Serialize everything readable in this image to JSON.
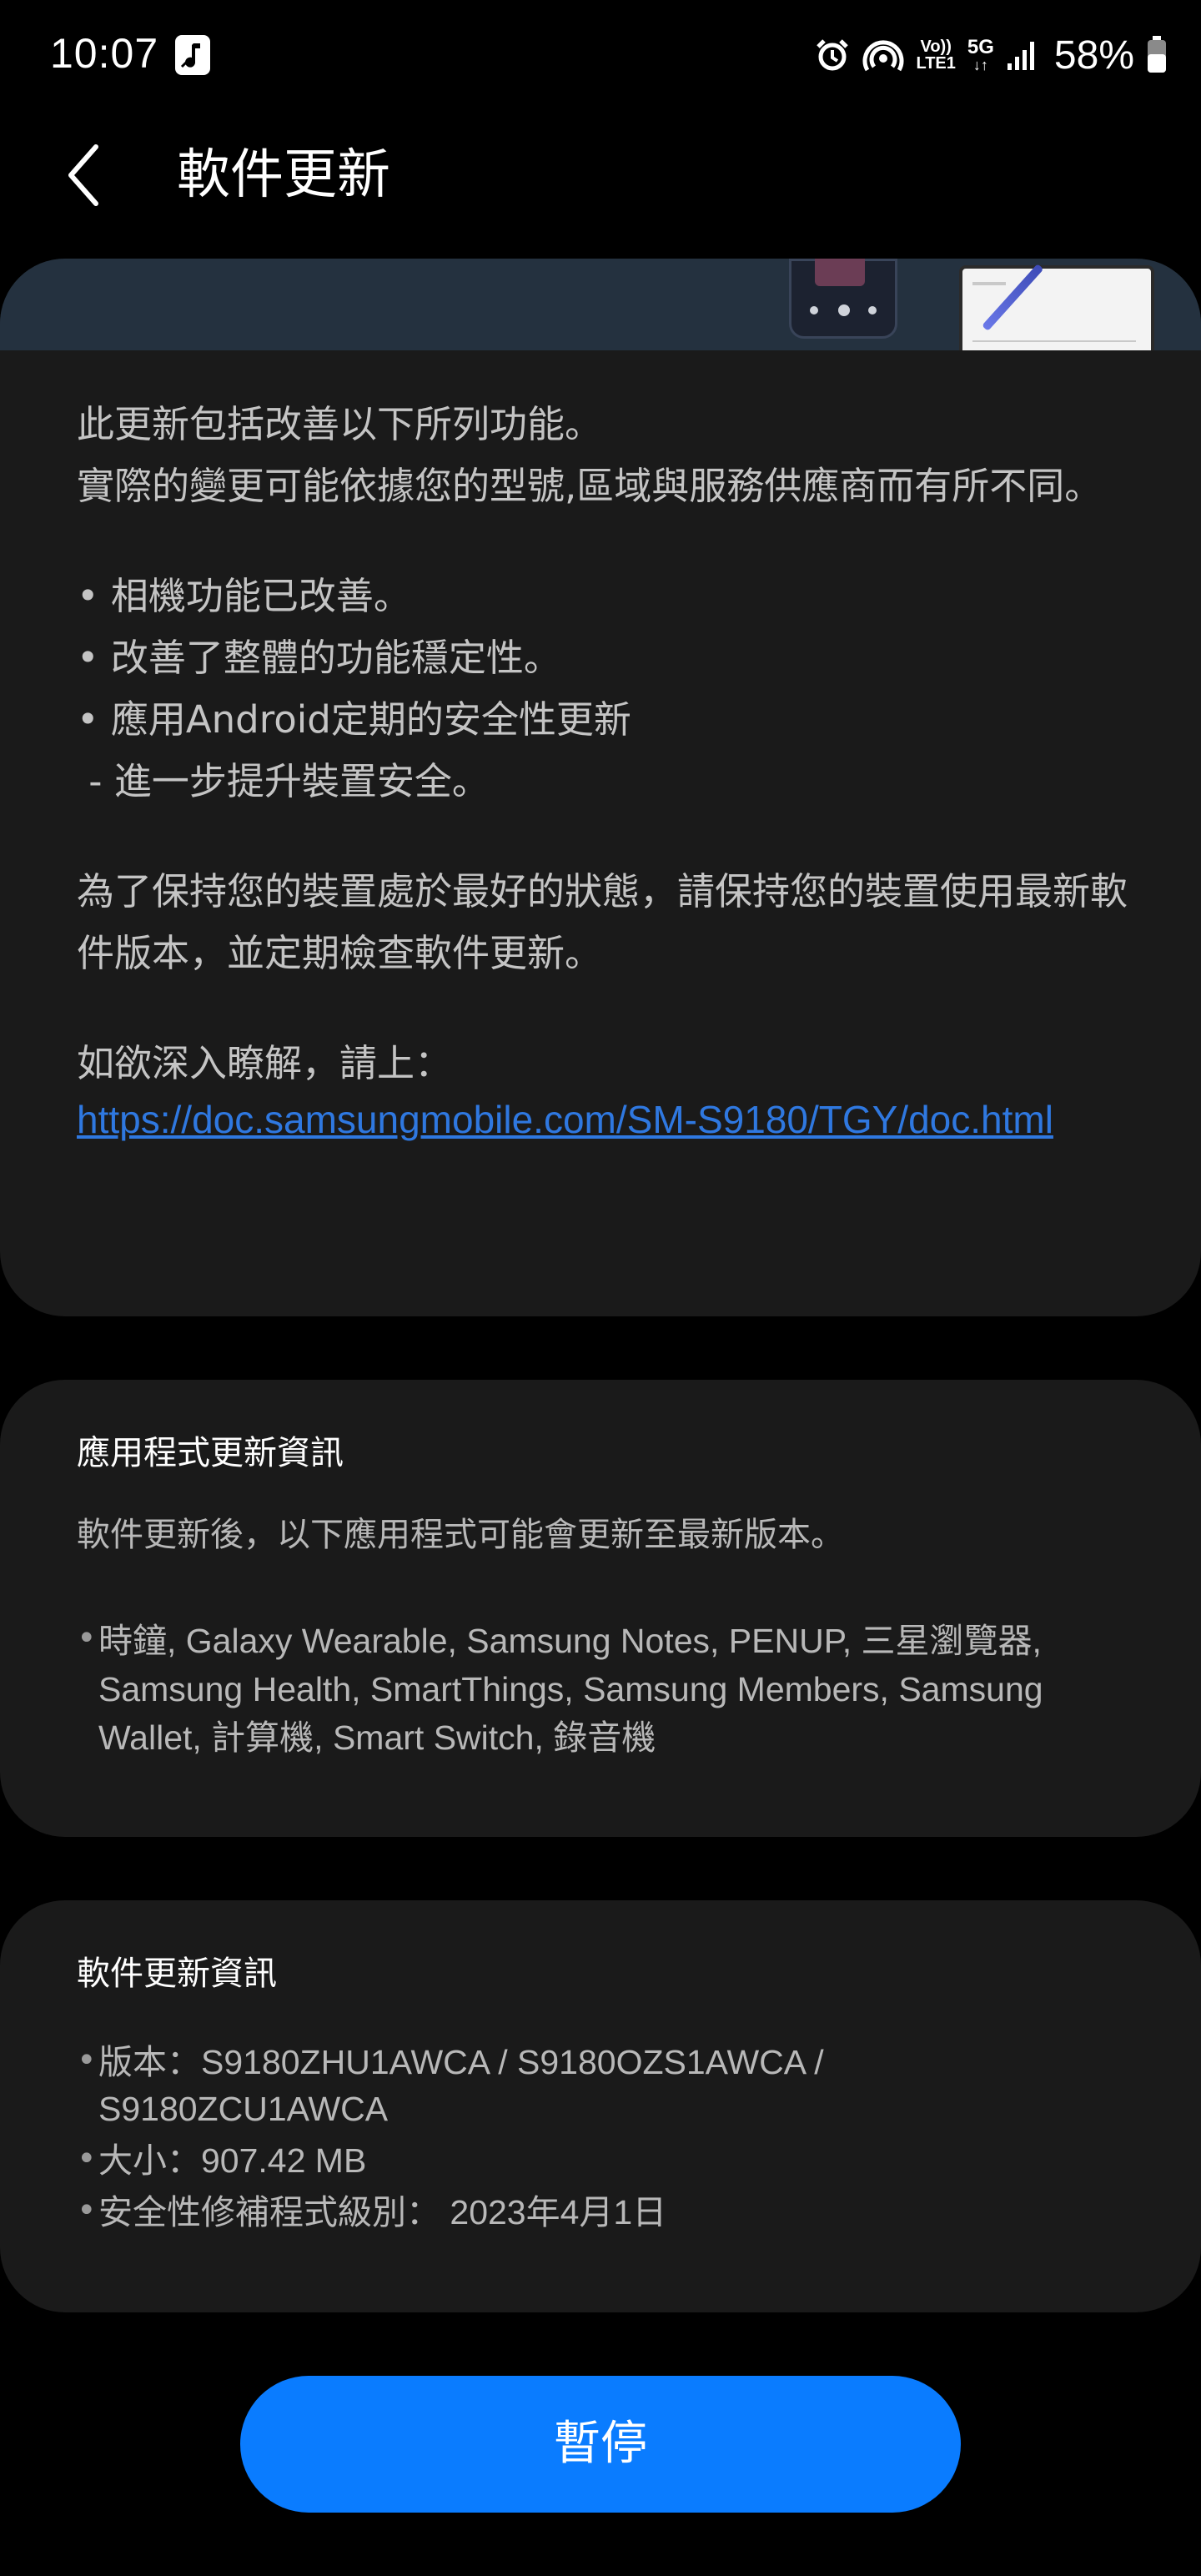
{
  "status_bar": {
    "time": "10:07",
    "battery_percent": "58%",
    "network_label": "5G",
    "volte_top": "Vo))",
    "volte_bottom": "LTE1",
    "icons": [
      "app-notification-icon",
      "alarm-icon",
      "hotspot-icon",
      "volte-icon",
      "5g-data-icon",
      "signal-icon",
      "battery-icon"
    ]
  },
  "header": {
    "title": "軟件更新",
    "back_icon": "chevron-left-icon"
  },
  "release_notes": {
    "intro_line_1": "此更新包括改善以下所列功能。",
    "intro_line_2": "實際的變更可能依據您的型號,區域與服務供應商而有所不同。",
    "bullets": [
      "• 相機功能已改善。",
      "• 改善了整體的功能穩定性。",
      "• 應用Android定期的安全性更新",
      " - 進一步提升裝置安全。"
    ],
    "advice": "為了保持您的裝置處於最好的狀態，請保持您的裝置使用最新軟件版本，並定期檢查軟件更新。",
    "more_info_label": "如欲深入瞭解，請上：",
    "link": "https://doc.samsungmobile.com/SM-S9180/TGY/doc.html"
  },
  "app_update_info": {
    "title": "應用程式更新資訊",
    "description": "軟件更新後，以下應用程式可能會更新至最新版本。",
    "bullet": "•",
    "apps": "時鐘, Galaxy Wearable, Samsung Notes, PENUP, 三星瀏覽器, Samsung Health, SmartThings, Samsung Members, Samsung Wallet, 計算機, Smart Switch, 錄音機"
  },
  "software_update_info": {
    "title": "軟件更新資訊",
    "bullet": "•",
    "version": "版本：S9180ZHU1AWCA / S9180OZS1AWCA / S9180ZCU1AWCA",
    "size": "大小：907.42 MB",
    "security_patch": "安全性修補程式級別： 2023年4月1日"
  },
  "actions": {
    "pause_label": "暫停"
  },
  "colors": {
    "background": "#000000",
    "card": "#1a1a1a",
    "link": "#2f78e0",
    "primary_button": "#0a7cff"
  }
}
